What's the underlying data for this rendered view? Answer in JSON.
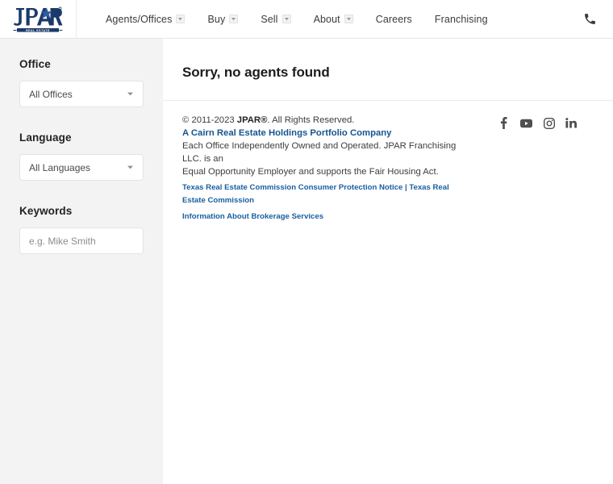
{
  "header": {
    "logo": {
      "name": "jpar-logo",
      "primary_text": "JPAR",
      "sub_text": "— REAL ESTATE —",
      "color": "#1b3a6b"
    },
    "nav_items": [
      {
        "label": "Agents/Offices",
        "has_dropdown": true
      },
      {
        "label": "Buy",
        "has_dropdown": true
      },
      {
        "label": "Sell",
        "has_dropdown": true
      },
      {
        "label": "About",
        "has_dropdown": true
      },
      {
        "label": "Careers",
        "has_dropdown": false
      },
      {
        "label": "Franchising",
        "has_dropdown": false
      }
    ],
    "phone_icon": "phone-icon"
  },
  "sidebar": {
    "filters": [
      {
        "label": "Office",
        "control": "select",
        "value": "All Offices",
        "icon": "chevron-down-icon"
      },
      {
        "label": "Language",
        "control": "select",
        "value": "All Languages",
        "icon": "chevron-down-icon"
      },
      {
        "label": "Keywords",
        "control": "input",
        "value": "",
        "placeholder": "e.g. Mike Smith"
      }
    ]
  },
  "main": {
    "title": "Sorry, no agents found"
  },
  "footer": {
    "copyright_prefix": "© 2011-2023 ",
    "copyright_brand": "JPAR®",
    "copyright_suffix": ". All Rights Reserved.",
    "portfolio_link": "A Cairn Real Estate Holdings Portfolio Company",
    "disclaimer_line1": "Each Office Independently Owned and Operated. JPAR Franchising LLC. is an",
    "disclaimer_line2": "Equal Opportunity Employer and supports the Fair Housing Act.",
    "trec_link1": "Texas Real Estate Commission Consumer Protection Notice | Texas Real Estate Commission",
    "trec_link2": "Information About Brokerage Services",
    "socials": [
      {
        "name": "facebook-icon",
        "label": "Facebook"
      },
      {
        "name": "youtube-icon",
        "label": "YouTube"
      },
      {
        "name": "instagram-icon",
        "label": "Instagram"
      },
      {
        "name": "linkedin-icon",
        "label": "LinkedIn"
      }
    ]
  },
  "colors": {
    "link_blue": "#14558e",
    "link_blue_small": "#1a5fa0",
    "logo_navy": "#1b3a6b",
    "sidebar_bg": "#f3f3f3",
    "text_dark": "#3d3d3d"
  }
}
